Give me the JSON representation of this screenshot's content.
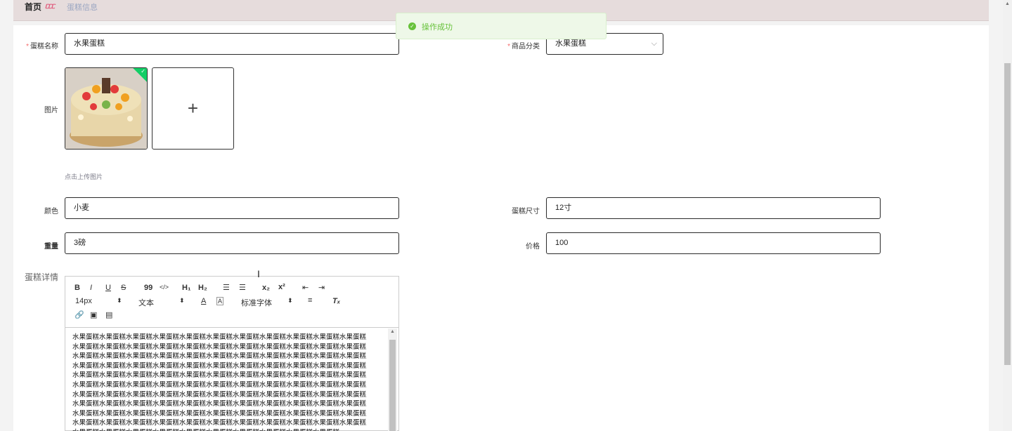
{
  "breadcrumb": {
    "home": "首页",
    "separator": "ᥴᥴᥴ",
    "current": "蛋糕信息"
  },
  "toast": {
    "message": "操作成功",
    "icon": "success-check-icon",
    "color": "#67c23a"
  },
  "form": {
    "name": {
      "label": "蛋糕名称",
      "value": "水果蛋糕"
    },
    "category": {
      "label": "商品分类",
      "value": "水果蛋糕"
    },
    "image": {
      "label": "图片",
      "hint": "点击上传图片"
    },
    "color": {
      "label": "颜色",
      "value": "小麦"
    },
    "size": {
      "label": "蛋糕尺寸",
      "value": "12寸"
    },
    "weight": {
      "label": "重量",
      "value": "3磅"
    },
    "price": {
      "label": "价格",
      "value": "100"
    },
    "detail": {
      "label": "蛋糕详情",
      "font_size": "14px",
      "text_style": "文本",
      "font_family": "标准字体",
      "content": "水果蛋糕水果蛋糕水果蛋糕水果蛋糕水果蛋糕水果蛋糕水果蛋糕水果蛋糕水果蛋糕水果蛋糕水果蛋糕水果蛋糕水果蛋糕水果蛋糕水果蛋糕水果蛋糕水果蛋糕水果蛋糕水果蛋糕水果蛋糕水果蛋糕水果蛋糕水果蛋糕水果蛋糕水果蛋糕水果蛋糕水果蛋糕水果蛋糕水果蛋糕水果蛋糕水果蛋糕水果蛋糕水果蛋糕水果蛋糕水果蛋糕水果蛋糕水果蛋糕水果蛋糕水果蛋糕水果蛋糕水果蛋糕水果蛋糕水果蛋糕水果蛋糕水果蛋糕水果蛋糕水果蛋糕水果蛋糕水果蛋糕水果蛋糕水果蛋糕水果蛋糕水果蛋糕水果蛋糕水果蛋糕水果蛋糕水果蛋糕水果蛋糕水果蛋糕水果蛋糕水果蛋糕水果蛋糕水果蛋糕水果蛋糕水果蛋糕水果蛋糕水果蛋糕水果蛋糕水果蛋糕水果蛋糕水果蛋糕水果蛋糕水果蛋糕水果蛋糕水果蛋糕水果蛋糕水果蛋糕水果蛋糕水果蛋糕水果蛋糕水果蛋糕水果蛋糕水果蛋糕水果蛋糕水果蛋糕水果蛋糕水果蛋糕水果蛋糕水果蛋糕水果蛋糕水果蛋糕水果蛋糕水果蛋糕水果蛋糕水果蛋糕水果蛋糕水果蛋糕水果蛋糕水果蛋糕水果蛋糕水果蛋糕水果蛋糕水果蛋糕水果蛋糕水果蛋糕水果蛋糕水果蛋糕水果蛋糕水果蛋糕水果蛋糕水果蛋糕水果蛋糕水果蛋糕水果蛋糕水果蛋糕水果蛋糕水果蛋糕水果蛋糕水果蛋糕水果蛋糕"
    }
  },
  "toolbar_glyphs": {
    "bold": "B",
    "italic": "I",
    "underline": "U",
    "strike": "S",
    "quote": "99",
    "code": "</>",
    "h1": "H₁",
    "h2": "H₂",
    "sub": "x₂",
    "sup": "x²",
    "clean": "Tₓ"
  }
}
